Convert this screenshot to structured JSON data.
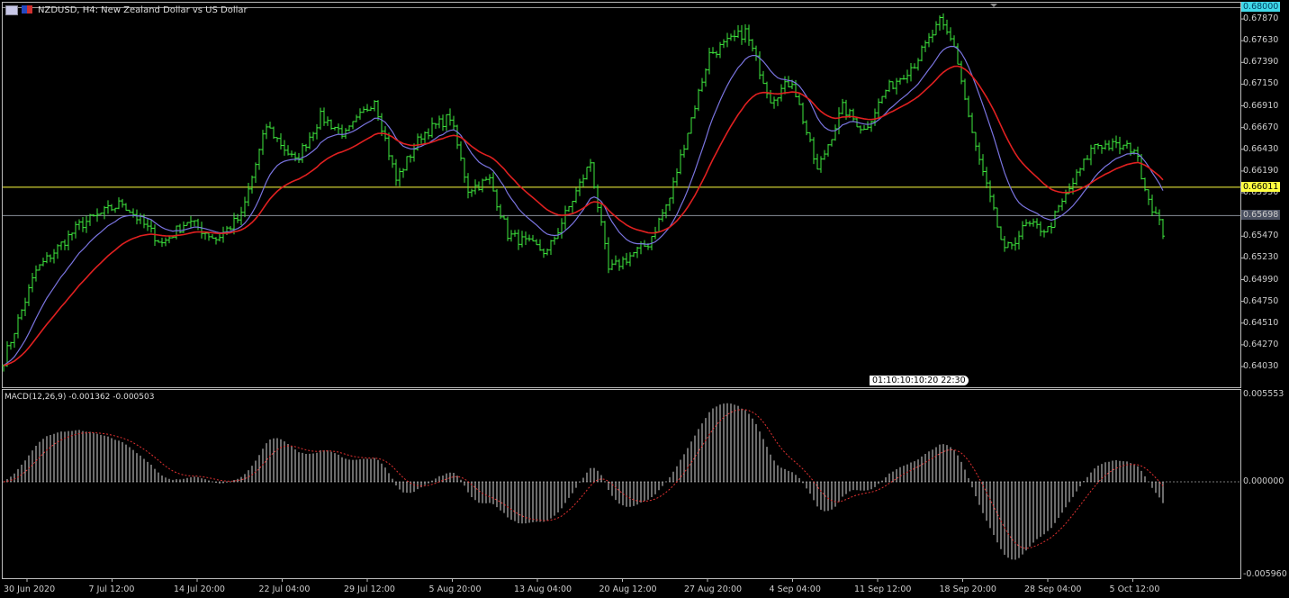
{
  "window": {
    "symbol_title": "NZDUSD, H4:  New Zealand Dollar vs US Dollar"
  },
  "price_axis": {
    "top_label": "0.68000",
    "ticks": [
      "0.67870",
      "0.67630",
      "0.67390",
      "0.67150",
      "0.66910",
      "0.66670",
      "0.66430",
      "0.66190",
      "0.65950",
      "0.65470",
      "0.65230",
      "0.64990",
      "0.64750",
      "0.64510",
      "0.64270",
      "0.64030"
    ],
    "yellow_line": "0.66011",
    "gray_line": "0.65698",
    "max": 0.68,
    "min": 0.6403
  },
  "macd": {
    "label": "MACD(12,26,9) -0.001362 -0.000503",
    "top": "0.005553",
    "zero": "0.000000",
    "bottom": "-0.005960",
    "max": 0.005553,
    "min": -0.00596
  },
  "countdown": {
    "text": "01:10:10:10:20  22:30"
  },
  "time_labels": [
    "30 Jun 2020",
    "7 Jul 12:00",
    "14 Jul 20:00",
    "22 Jul 04:00",
    "29 Jul 12:00",
    "5 Aug 20:00",
    "13 Aug 04:00",
    "20 Aug 12:00",
    "27 Aug 20:00",
    "4 Sep 04:00",
    "11 Sep 12:00",
    "18 Sep 20:00",
    "28 Sep 04:00",
    "5 Oct 12:00"
  ],
  "colors": {
    "bars": "#3ee83e",
    "fast_ma": "#7a74e0",
    "slow_ma": "#e02020",
    "yellow": "#ffff40",
    "cyan": "#40d8e8",
    "gray": "#8a8f99",
    "hist": "#d8d8d8",
    "signal": "#e03030"
  },
  "chart_data": {
    "type": "ohlc-bar",
    "price_anchors": [
      [
        0,
        0.641
      ],
      [
        9,
        0.6509
      ],
      [
        21,
        0.6559
      ],
      [
        33,
        0.6584
      ],
      [
        44,
        0.6539
      ],
      [
        51,
        0.6564
      ],
      [
        59,
        0.6544
      ],
      [
        66,
        0.6569
      ],
      [
        73,
        0.6669
      ],
      [
        81,
        0.6629
      ],
      [
        88,
        0.6679
      ],
      [
        95,
        0.6659
      ],
      [
        103,
        0.6699
      ],
      [
        109,
        0.6609
      ],
      [
        116,
        0.6659
      ],
      [
        124,
        0.6679
      ],
      [
        129,
        0.6599
      ],
      [
        135,
        0.6609
      ],
      [
        140,
        0.6549
      ],
      [
        151,
        0.6529
      ],
      [
        163,
        0.6629
      ],
      [
        168,
        0.6509
      ],
      [
        179,
        0.6539
      ],
      [
        185,
        0.6589
      ],
      [
        189,
        0.6649
      ],
      [
        196,
        0.6748
      ],
      [
        206,
        0.6773
      ],
      [
        213,
        0.6699
      ],
      [
        219,
        0.6719
      ],
      [
        226,
        0.6619
      ],
      [
        233,
        0.6689
      ],
      [
        239,
        0.6664
      ],
      [
        245,
        0.6708
      ],
      [
        253,
        0.6738
      ],
      [
        260,
        0.6783
      ],
      [
        264,
        0.6758
      ],
      [
        269,
        0.6659
      ],
      [
        278,
        0.6529
      ],
      [
        284,
        0.6559
      ],
      [
        290,
        0.6554
      ],
      [
        296,
        0.6599
      ],
      [
        303,
        0.6649
      ],
      [
        314,
        0.6644
      ],
      [
        318,
        0.6589
      ],
      [
        322,
        0.6551
      ]
    ]
  }
}
